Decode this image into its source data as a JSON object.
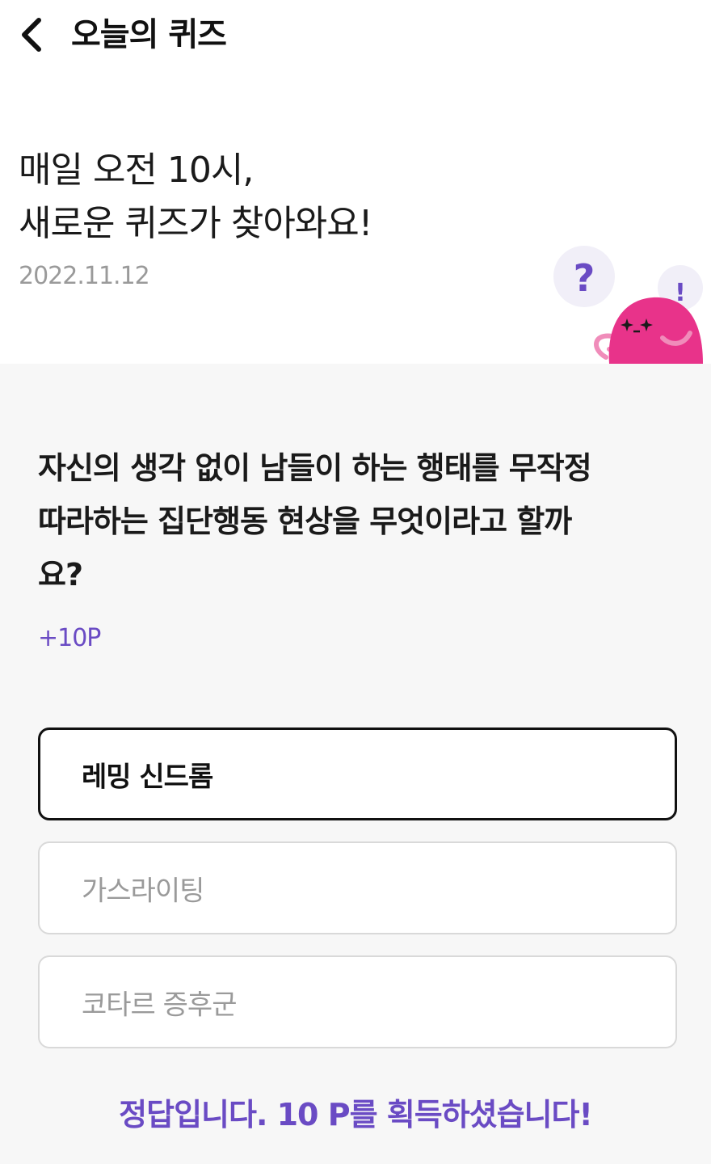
{
  "header": {
    "back_icon": "chevron-left-icon",
    "title": "오늘의 퀴즈"
  },
  "intro": {
    "line1": "매일 오전 10시,",
    "line2": "새로운 퀴즈가 찾아와요!",
    "date": "2022.11.12"
  },
  "mascot": {
    "question_mark": "?",
    "exclamation_mark": "!",
    "body_color": "#e8338a",
    "accent_color": "#6a4bc4"
  },
  "quiz": {
    "question_lines": [
      "자신의 생각 없이 남들이 하는 행태를 무작정",
      "따라하는 집단행동 현상을 무엇이라고 할까",
      "요?"
    ],
    "points": "+10P",
    "options": [
      {
        "label": "레밍 신드롬",
        "selected": true
      },
      {
        "label": "가스라이팅",
        "selected": false
      },
      {
        "label": "코타르 증후군",
        "selected": false
      }
    ],
    "result": "정답입니다. 10 P를 획득하셨습니다!"
  },
  "colors": {
    "accent": "#6a4bc4",
    "background": "#f7f7f7",
    "selected_border": "#111111",
    "option_border": "#d9d9d9"
  }
}
